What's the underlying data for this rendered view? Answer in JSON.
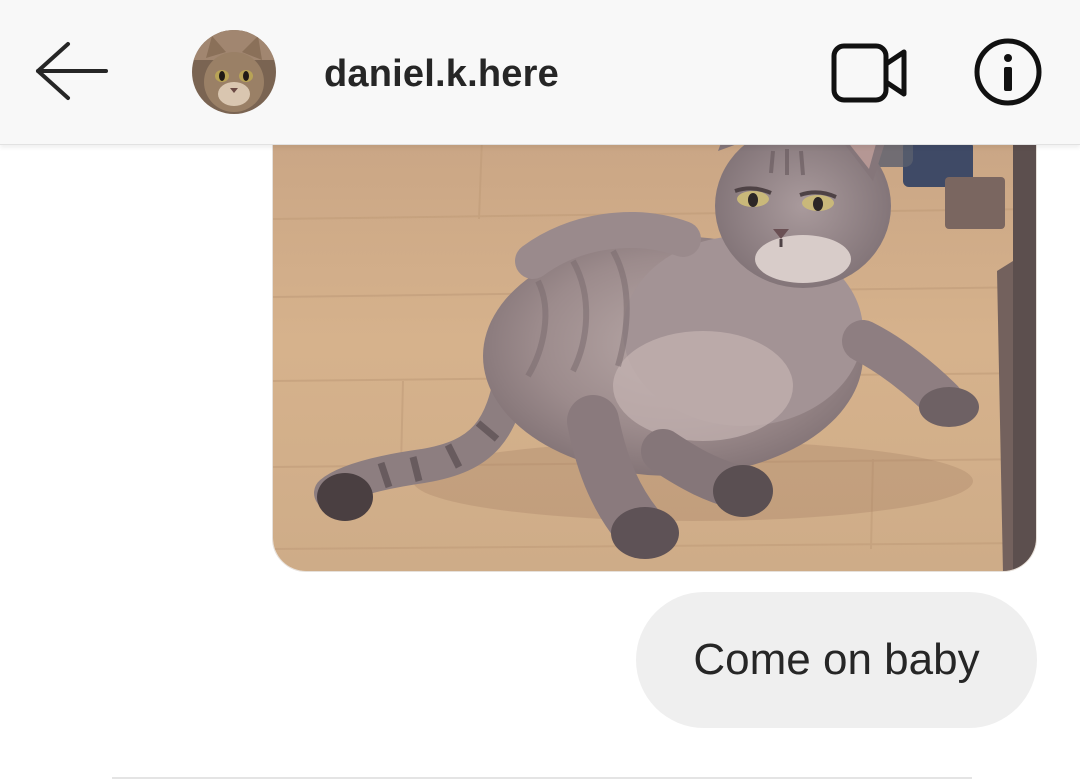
{
  "header": {
    "back_icon": "arrow-left-icon",
    "avatar_alt": "cat-avatar",
    "username": "daniel.k.here",
    "video_icon": "video-camera-icon",
    "info_icon": "info-icon"
  },
  "messages": [
    {
      "type": "photo",
      "image": "cat-lying-on-floor-photo"
    },
    {
      "type": "text",
      "text": "Come on baby"
    }
  ],
  "colors": {
    "header_bg": "#f8f8f8",
    "bubble_bg": "#efefef",
    "text": "#262626"
  }
}
